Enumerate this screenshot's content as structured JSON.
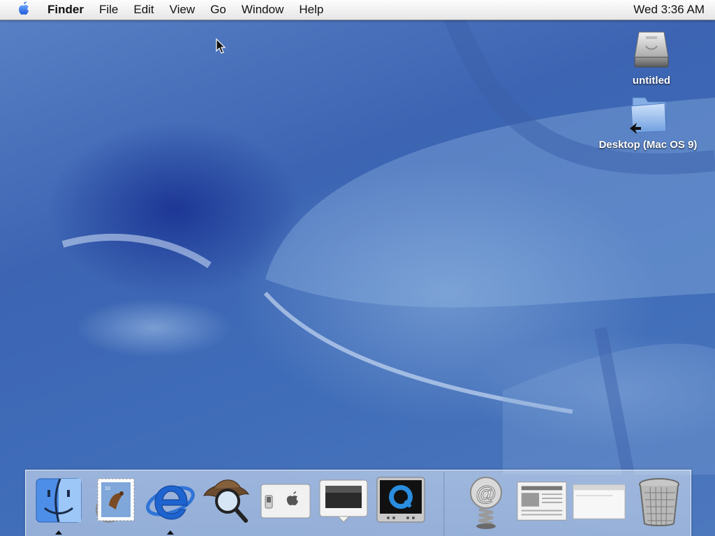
{
  "menubar": {
    "apple_icon": "apple-logo-icon",
    "app_name": "Finder",
    "items": [
      "File",
      "Edit",
      "View",
      "Go",
      "Window",
      "Help"
    ],
    "clock": "Wed 3:36 AM"
  },
  "desktop": {
    "icons": [
      {
        "label": "untitled",
        "icon": "hard-drive-icon"
      },
      {
        "label": "Desktop (Mac OS 9)",
        "icon": "folder-alias-icon"
      }
    ],
    "accent": "#3f6cb8"
  },
  "dock": {
    "items": [
      {
        "icon": "finder-icon",
        "running": true
      },
      {
        "icon": "mail-stamp-icon",
        "running": false
      },
      {
        "icon": "internet-explorer-icon",
        "running": true
      },
      {
        "icon": "sherlock-icon",
        "running": false
      },
      {
        "icon": "system-preferences-switch-icon",
        "running": false
      },
      {
        "icon": "monitor-display-icon",
        "running": false
      },
      {
        "icon": "quicktime-icon",
        "running": false
      },
      {
        "icon": "at-sign-spring-icon",
        "running": false
      },
      {
        "icon": "newspaper-icon",
        "running": false
      },
      {
        "icon": "minimized-window-icon",
        "running": false
      },
      {
        "icon": "trash-icon",
        "running": false
      }
    ]
  }
}
